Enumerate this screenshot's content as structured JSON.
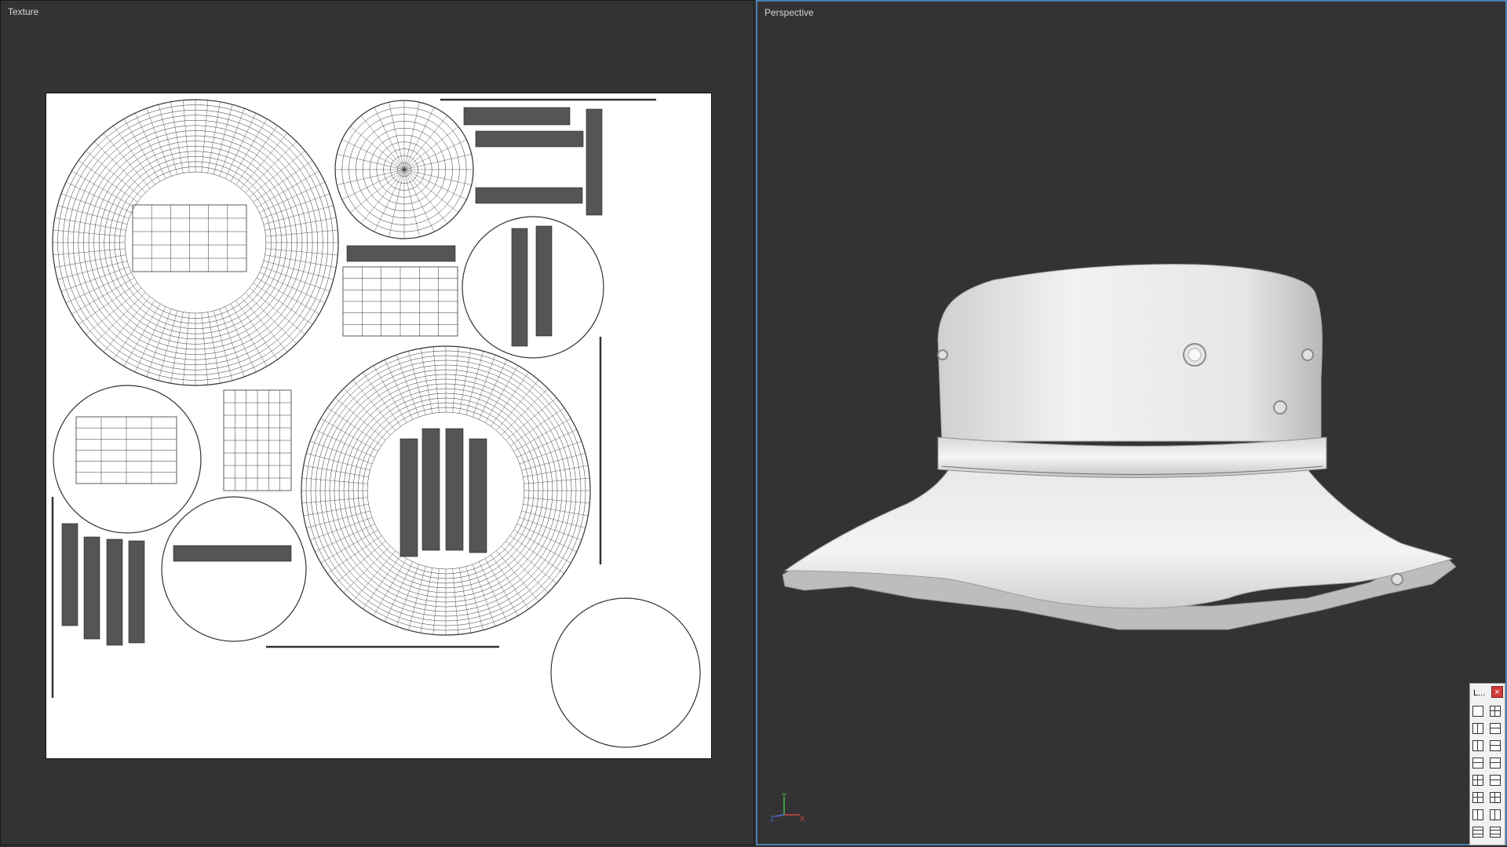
{
  "texture_viewport": {
    "title": "Texture"
  },
  "perspective_viewport": {
    "title": "Perspective"
  },
  "axis_gizmo": {
    "y": "Y",
    "z": "Z",
    "x": "X"
  },
  "layout_panel": {
    "title": "L...",
    "close": "×",
    "buttons": [
      "single",
      "quad",
      "split-vertical",
      "split-horizontal",
      "split-vertical",
      "split-horizontal",
      "split-horizontal",
      "split-horizontal",
      "quad",
      "split-horizontal",
      "quad",
      "quad",
      "three-left",
      "three-right",
      "three-top",
      "three-bottom"
    ]
  },
  "colors": {
    "background": "#333333",
    "active_border": "#4d7fb3",
    "uv_sheet": "#ffffff"
  }
}
